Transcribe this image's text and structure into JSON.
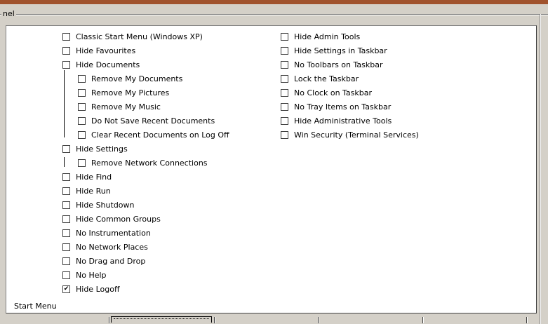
{
  "group": {
    "title": "nel"
  },
  "panel": {
    "label": "Start Menu"
  },
  "left_column": [
    {
      "label": "Classic Start Menu (Windows XP)",
      "checked": false,
      "indent": 0
    },
    {
      "label": "Hide Favourites",
      "checked": false,
      "indent": 0
    },
    {
      "label": "Hide Documents",
      "checked": false,
      "indent": 0
    },
    {
      "label": "Remove My Documents",
      "checked": false,
      "indent": 1
    },
    {
      "label": "Remove My Pictures",
      "checked": false,
      "indent": 1
    },
    {
      "label": "Remove My Music",
      "checked": false,
      "indent": 1
    },
    {
      "label": "Do Not Save Recent Documents",
      "checked": false,
      "indent": 1
    },
    {
      "label": "Clear Recent Documents on Log Off",
      "checked": false,
      "indent": 1
    },
    {
      "label": "Hide Settings",
      "checked": false,
      "indent": 0
    },
    {
      "label": "Remove Network Connections",
      "checked": false,
      "indent": 1
    },
    {
      "label": "Hide Find",
      "checked": false,
      "indent": 0
    },
    {
      "label": "Hide Run",
      "checked": false,
      "indent": 0
    },
    {
      "label": "Hide Shutdown",
      "checked": false,
      "indent": 0
    },
    {
      "label": "Hide Common Groups",
      "checked": false,
      "indent": 0
    },
    {
      "label": "No Instrumentation",
      "checked": false,
      "indent": 0
    },
    {
      "label": "No Network Places",
      "checked": false,
      "indent": 0
    },
    {
      "label": "No Drag and Drop",
      "checked": false,
      "indent": 0
    },
    {
      "label": "No Help",
      "checked": false,
      "indent": 0
    },
    {
      "label": "Hide Logoff",
      "checked": true,
      "indent": 0
    }
  ],
  "right_column": [
    {
      "label": "Hide Admin Tools",
      "checked": false
    },
    {
      "label": "Hide Settings in Taskbar",
      "checked": false
    },
    {
      "label": "No Toolbars on Taskbar",
      "checked": false
    },
    {
      "label": "Lock the Taskbar",
      "checked": false
    },
    {
      "label": "No Clock on Taskbar",
      "checked": false
    },
    {
      "label": "No Tray Items on Taskbar",
      "checked": false
    },
    {
      "label": "Hide Administrative Tools",
      "checked": false
    },
    {
      "label": "Win Security (Terminal Services)",
      "checked": false
    }
  ],
  "colors": {
    "window_bg": "#d4d0c8",
    "panel_bg": "#ffffff",
    "top_strip": "#a0522d"
  }
}
